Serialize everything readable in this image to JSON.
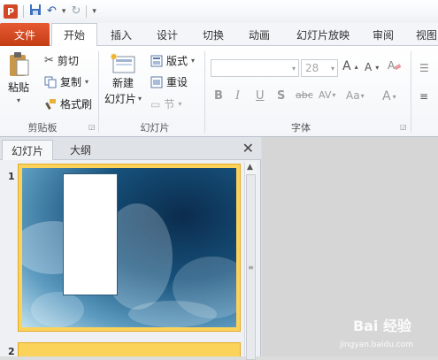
{
  "tabs": [
    {
      "label": "文件"
    },
    {
      "label": "开始"
    },
    {
      "label": "插入"
    },
    {
      "label": "设计"
    },
    {
      "label": "切换"
    },
    {
      "label": "动画"
    },
    {
      "label": "幻灯片放映"
    },
    {
      "label": "审阅"
    },
    {
      "label": "视图"
    }
  ],
  "clipboard": {
    "paste": "粘贴",
    "cut": "剪切",
    "copy": "复制",
    "format_painter": "格式刷",
    "group": "剪贴板"
  },
  "slides": {
    "new_slide_line1": "新建",
    "new_slide_line2": "幻灯片",
    "layout": "版式",
    "reset": "重设",
    "section": "节",
    "group": "幻灯片"
  },
  "font": {
    "size": "28",
    "group": "字体",
    "bold": "B",
    "italic": "I",
    "underline": "U",
    "shadow": "S",
    "strike": "abc",
    "spacing": "AV",
    "case": "Aa",
    "color": "A",
    "grow": "A",
    "shrink": "A"
  },
  "pane": {
    "tab_slides": "幻灯片",
    "tab_outline": "大纲",
    "close": "✕",
    "slide1_num": "1",
    "slide2_num": "2"
  },
  "watermark": {
    "brand": "Bai 经验",
    "url": "jingyan.baidu.com"
  }
}
